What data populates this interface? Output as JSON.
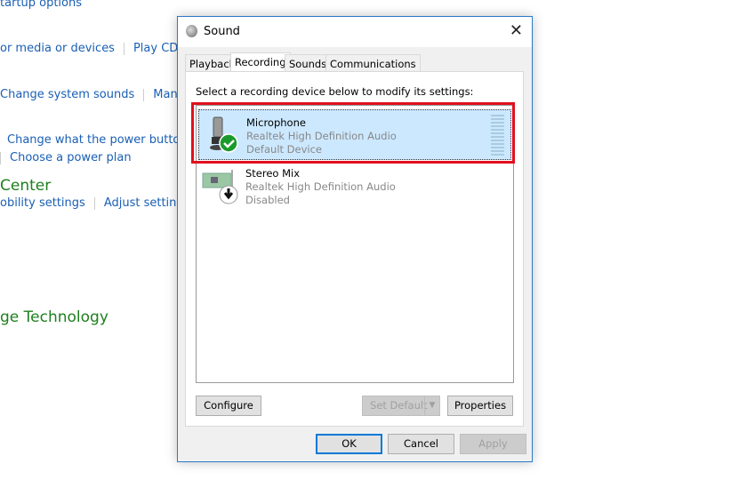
{
  "background": {
    "startup": "tartup options",
    "row1": [
      "or media or devices",
      "Play CDs or"
    ],
    "row2": [
      "Change system sounds",
      "Manage"
    ],
    "row3": "Change what the power buttons d",
    "row4": "Choose a power plan",
    "heading1": "Center",
    "row5": [
      "obility settings",
      "Adjust settings be"
    ],
    "heading2": "ge Technology"
  },
  "dialog": {
    "title": "Sound",
    "tabs": [
      {
        "label": "Playback"
      },
      {
        "label": "Recording",
        "active": true
      },
      {
        "label": "Sounds"
      },
      {
        "label": "Communications"
      }
    ],
    "instruction": "Select a recording device below to modify its settings:",
    "devices": [
      {
        "name": "Microphone",
        "driver": "Realtek High Definition Audio",
        "status": "Default Device",
        "icon": "microphone-icon",
        "badge": "green-check",
        "selected": true
      },
      {
        "name": "Stereo Mix",
        "driver": "Realtek High Definition Audio",
        "status": "Disabled",
        "icon": "sound-card-icon",
        "badge": "down-arrow"
      }
    ],
    "buttons": {
      "configure": "Configure",
      "set_default": "Set Default",
      "properties": "Properties",
      "ok": "OK",
      "cancel": "Cancel",
      "apply": "Apply"
    },
    "highlight_color": "#e0101e"
  }
}
